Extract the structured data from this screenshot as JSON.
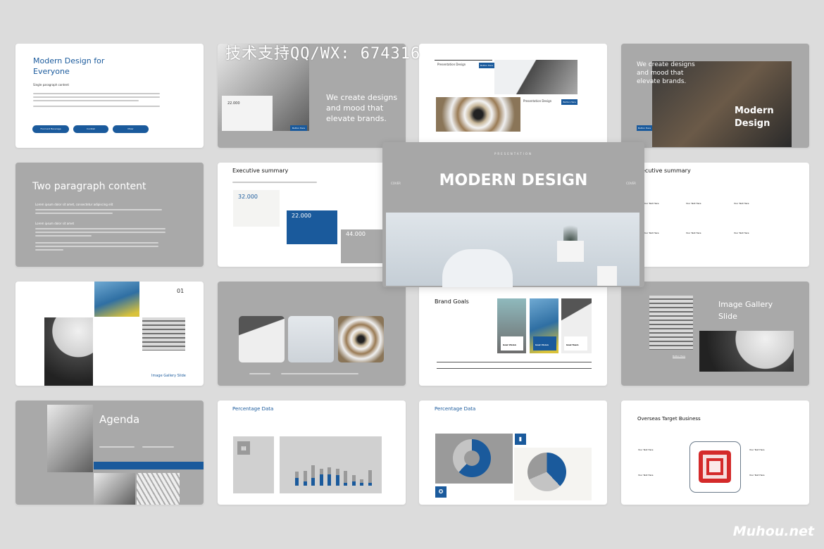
{
  "watermark": "技术支持QQ/WX: 674316",
  "watermark_site": "Muhou.net",
  "colors": {
    "accent": "#1a5a9c",
    "gray_slide": "#a9a9a9",
    "background": "#dcdcdc",
    "target_red": "#d42a2a"
  },
  "cover": {
    "kicker": "PRESENTATION",
    "title": "MODERN DESIGN",
    "left_tag": "COVER",
    "right_tag": "COVER"
  },
  "s1": {
    "title_line1": "Modern Design for",
    "title_line2": "Everyone",
    "subtitle": "Single paragraph content",
    "buttons": [
      "Food and Beverage",
      "Cocktail",
      "Mixer"
    ]
  },
  "s2": {
    "number": "22.000",
    "tagline_1": "We create designs",
    "tagline_2": "and mood that",
    "tagline_3": "elevate brands.",
    "button": "Button Here"
  },
  "s3": {
    "label_1": "Presentation Design",
    "label_2": "Presentation Design",
    "button": "Button Here"
  },
  "s4": {
    "tagline_1": "We create designs",
    "tagline_2": "and mood that",
    "tagline_3": "elevate brands.",
    "title_1": "Modern",
    "title_2": "Design",
    "button": "Button Here"
  },
  "s5": {
    "title": "Two paragraph content",
    "bullet_1": "Lorem ipsum dolor sit amet, consectetur adipiscing elit",
    "bullet_2": "Lorem ipsum dolor sit amet"
  },
  "s6": {
    "title": "Executive summary",
    "stats": [
      {
        "value": "32.000"
      },
      {
        "value": "22.000"
      },
      {
        "value": "44.000"
      }
    ]
  },
  "s8": {
    "title": "ecutive summary",
    "items": [
      "Your Text Here",
      "Your Text Here",
      "Your Text Here",
      "Your Text Here",
      "Your Text Here",
      "Your Text Here"
    ]
  },
  "s9": {
    "number": "01",
    "caption": "Image Gallery Slide"
  },
  "s11": {
    "title": "Brand Goals",
    "cards": [
      "Goal Vision",
      "Goal Vision",
      "Goal Team"
    ]
  },
  "s12": {
    "title_1": "Image Gallery",
    "title_2": "Slide",
    "button": "Button Here"
  },
  "s13": {
    "title": "Agenda"
  },
  "s14": {
    "title": "Percentage Data",
    "bars": [
      [
        0.45,
        0.35
      ],
      [
        0.25,
        0.6
      ],
      [
        0.45,
        0.7
      ],
      [
        0.65,
        0.3
      ],
      [
        0.65,
        0.4
      ],
      [
        0.6,
        0.35
      ],
      [
        0.15,
        0.7
      ],
      [
        0.25,
        0.35
      ],
      [
        0.15,
        0.2
      ],
      [
        0.15,
        0.75
      ]
    ]
  },
  "s15": {
    "title": "Percentage Data",
    "donut_fraction": 0.62,
    "pie_fraction": 0.38
  },
  "s16": {
    "title": "Overseas Target Business",
    "items": [
      "Your Text Here",
      "Your Text Here",
      "Your Text Here",
      "Your Text Here"
    ]
  }
}
